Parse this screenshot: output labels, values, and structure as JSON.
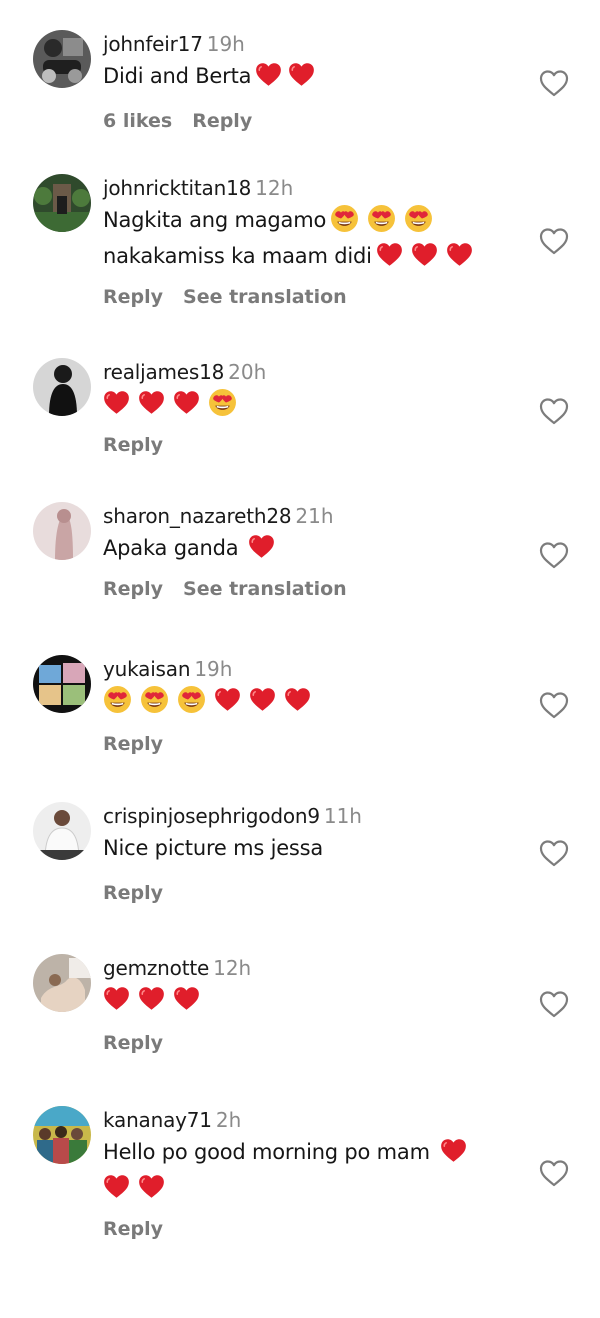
{
  "comments": [
    {
      "username": "johnfeir17",
      "time": "19h",
      "text": "Didi and Berta",
      "emoji_after": [
        "heart",
        "heart"
      ],
      "likes": "6 likes",
      "reply": "Reply",
      "avatar": "avatar-motorbike"
    },
    {
      "username": "johnricktitan18",
      "time": "12h",
      "text": "Nagkita ang magamo",
      "emoji_after": [
        "smile-hearts",
        "smile-hearts",
        "smile-hearts"
      ],
      "text2": "nakakamiss ka maam didi",
      "emoji_after2": [
        "heart",
        "heart",
        "heart"
      ],
      "reply": "Reply",
      "translate": "See translation",
      "avatar": "avatar-garden"
    },
    {
      "username": "realjames18",
      "time": "20h",
      "emoji_only": [
        "heart",
        "heart",
        "heart",
        "smile-hearts"
      ],
      "reply": "Reply",
      "avatar": "avatar-dark-figure"
    },
    {
      "username": "sharon_nazareth28",
      "time": "21h",
      "text": "Apaka ganda",
      "emoji_after": [
        "heart"
      ],
      "reply": "Reply",
      "translate": "See translation",
      "avatar": "avatar-pink"
    },
    {
      "username": "yukaisan",
      "time": "19h",
      "emoji_only": [
        "smile-hearts",
        "smile-hearts",
        "smile-hearts",
        "heart",
        "heart",
        "heart"
      ],
      "reply": "Reply",
      "avatar": "avatar-photos"
    },
    {
      "username": "crispinjosephrigodon9",
      "time": "11h",
      "text": "Nice picture ms jessa",
      "reply": "Reply",
      "avatar": "avatar-white-shirt"
    },
    {
      "username": "gemznotte",
      "time": "12h",
      "emoji_only": [
        "heart",
        "heart",
        "heart"
      ],
      "reply": "Reply",
      "avatar": "avatar-beige"
    },
    {
      "username": "kananay71",
      "time": "2h",
      "text": "Hello po good morning po mam",
      "emoji_after": [
        "heart"
      ],
      "emoji_line2": [
        "heart",
        "heart"
      ],
      "reply": "Reply",
      "avatar": "avatar-group"
    }
  ],
  "colors": {
    "heart": "#e01e2b",
    "muted": "#8a8a8a",
    "text": "#161616",
    "face": "#f6c23a"
  }
}
